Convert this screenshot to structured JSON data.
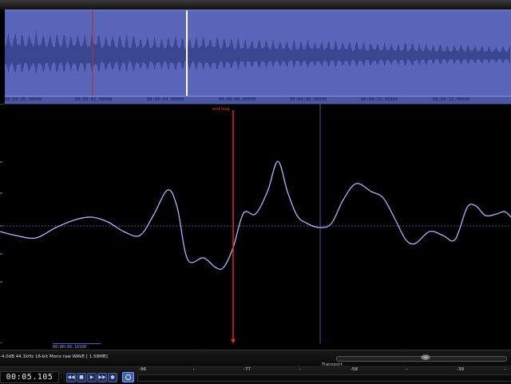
{
  "overview": {
    "ruler_ticks": [
      "00:00:00.00000",
      "00:00:02.00000",
      "00:00:04.00000",
      "00:00:06.00000",
      "00:00:08.00000",
      "00:00:10.00000",
      "00:00:12.00000"
    ],
    "colors": {
      "background": "#5865b8",
      "wave": "#3a4690",
      "playhead": "#ffffff",
      "loop_marker": "#c02a2a"
    }
  },
  "detail": {
    "end_loop_label": "end loop",
    "time_label": "00:00:05.10100",
    "colors": {
      "wave": "#aab4ff",
      "end_loop": "#ff2020",
      "cursor": "#3a4a8a",
      "grid": "#5a6ad0"
    }
  },
  "status": {
    "info": "-4.0dB   44.1kHz 16-bit Mono raw  WAVE [ 1.58MB]",
    "transport_label": "Transport",
    "transport_position": 0.53
  },
  "transport": {
    "time": "00:05.105",
    "buttons": [
      {
        "name": "rewind-button",
        "glyph": "◀◀"
      },
      {
        "name": "stop-button",
        "glyph": "■"
      },
      {
        "name": "play-button",
        "glyph": "▶"
      },
      {
        "name": "fast-forward-button",
        "glyph": "▶▶"
      },
      {
        "name": "record-button",
        "glyph": "●"
      }
    ]
  },
  "meter": {
    "labels": [
      "-96",
      "-77",
      "-58",
      "-39"
    ]
  }
}
